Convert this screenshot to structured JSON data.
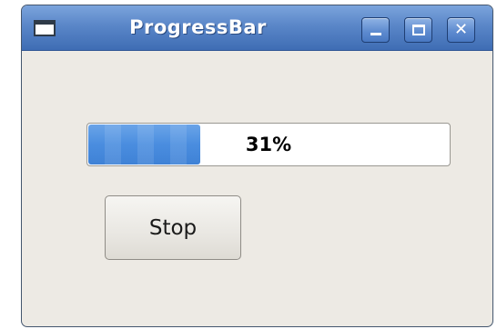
{
  "window": {
    "title": "ProgressBar",
    "icons": {
      "system": "window-icon",
      "minimize": "minimize-icon",
      "maximize": "maximize-icon",
      "close": "close-icon"
    },
    "colors": {
      "titlebar": "#5a86c8",
      "background": "#edeae4"
    }
  },
  "progress": {
    "value": 0.31,
    "label": "31%",
    "fill_color": "#4a8ddf"
  },
  "controls": {
    "stop_label": "Stop"
  }
}
